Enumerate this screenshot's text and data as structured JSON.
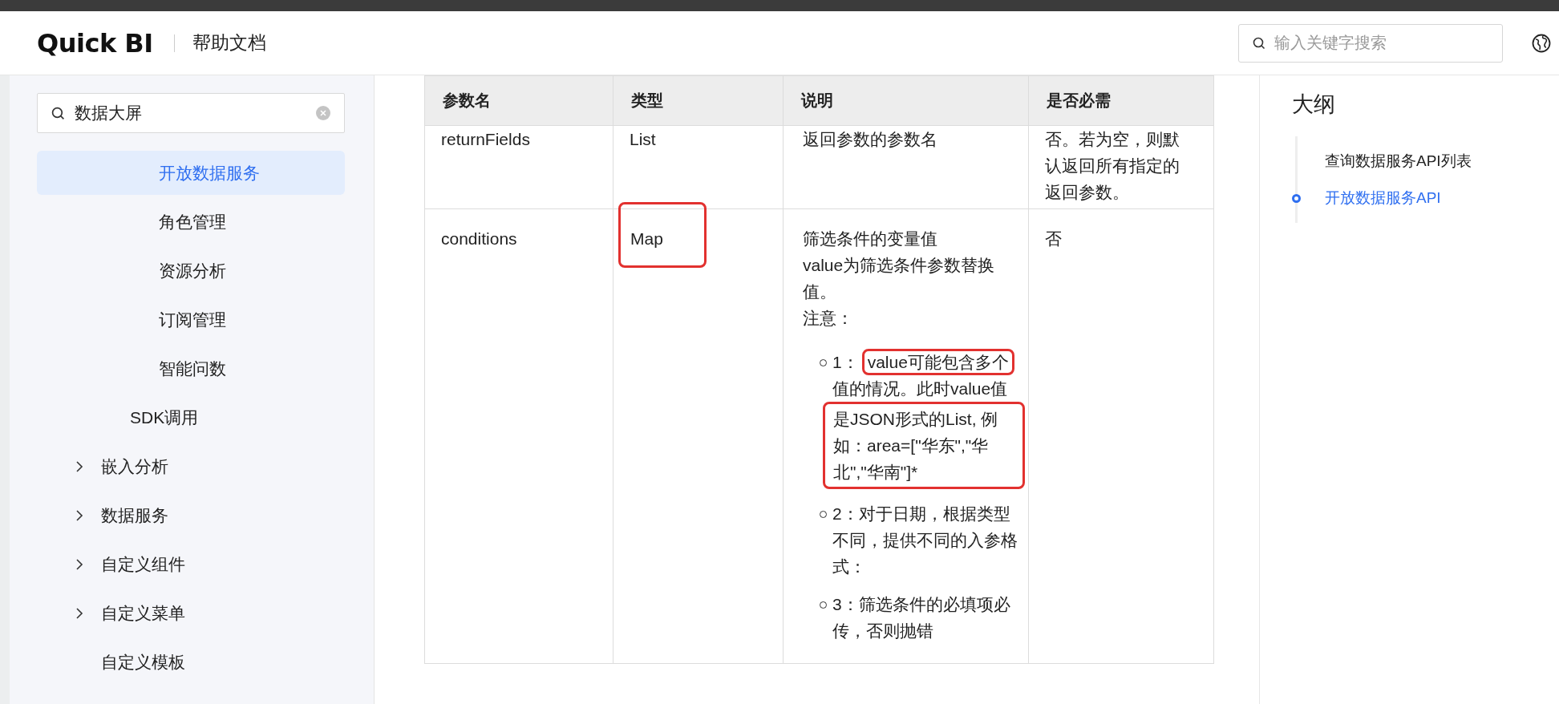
{
  "header": {
    "logo": "Quick BI",
    "title": "帮助文档",
    "search": {
      "placeholder": "输入关键字搜索"
    }
  },
  "sidebar": {
    "search": {
      "value": "数据大屏"
    },
    "items": [
      {
        "children": [
          {
            "children": [
              {
                "label": "开放数据服务",
                "selected": true
              },
              {
                "label": "角色管理",
                "selected": false
              },
              {
                "label": "资源分析",
                "selected": false
              },
              {
                "label": "订阅管理",
                "selected": false
              },
              {
                "label": "智能问数",
                "selected": false
              }
            ]
          },
          {
            "label": "SDK调用",
            "selected": false
          }
        ]
      },
      {
        "label": "嵌入分析",
        "selected": false,
        "expanded": false
      },
      {
        "label": "数据服务",
        "selected": false,
        "expanded": false
      },
      {
        "label": "自定义组件",
        "selected": false,
        "expanded": false
      },
      {
        "label": "自定义菜单",
        "selected": false,
        "expanded": false
      },
      {
        "label": "自定义模板",
        "selected": false
      }
    ]
  },
  "table": {
    "columns": [
      "参数名",
      "类型",
      "说明",
      "是否必需"
    ],
    "rows": [
      {
        "cells": [
          {
            "parts": [
              {
                "text": "returnFields"
              }
            ]
          },
          {
            "parts": [
              {
                "text": "List"
              }
            ]
          },
          {
            "parts": [
              {
                "text": "返回参数的参数名"
              }
            ]
          },
          {
            "parts": [
              {
                "text": "否。若为空，则默认返回所有指定的返回参数。"
              }
            ]
          }
        ]
      },
      {
        "cells": [
          {
            "parts": [
              {
                "text": "conditions"
              }
            ]
          },
          {
            "parts": [
              {
                "text": "Map",
                "boxed": true
              }
            ]
          },
          {
            "parts": [
              {
                "text": "筛选条件的变量值"
              },
              {
                "text": "value为筛选条件参数替换值。"
              },
              {
                "text": "注意："
              }
            ],
            "notes": [
              {
                "parts": [
                  {
                    "text": "1："
                  },
                  {
                    "text": "value可能包含多个",
                    "boxed": true
                  },
                  {
                    "text": "值的情况。此时value值"
                  },
                  {
                    "text": "是JSON形式的List, 例如：area=[\"华东\",\"华北\",\"华南\"]*",
                    "boxed": true
                  }
                ]
              },
              {
                "parts": [
                  {
                    "text": "2：对于日期，根据类型不同，提供不同的入参格式："
                  }
                ]
              },
              {
                "parts": [
                  {
                    "text": "3：筛选条件的必填项必传，否则抛错"
                  }
                ]
              }
            ]
          },
          {
            "parts": [
              {
                "text": "否"
              }
            ]
          }
        ]
      }
    ]
  },
  "outline": {
    "title": "大纲",
    "items": [
      {
        "label": "查询数据服务API列表",
        "selected": false
      },
      {
        "label": "开放数据服务API",
        "selected": true
      }
    ]
  }
}
